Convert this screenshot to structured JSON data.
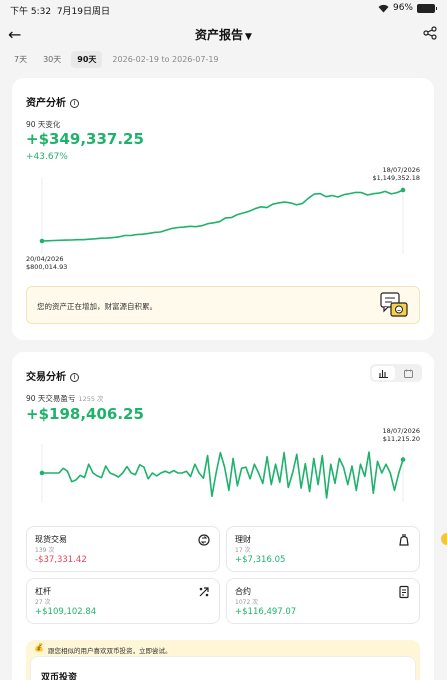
{
  "status_bar": {
    "time": "下午 5:32",
    "date": "7月19日周日",
    "battery": "96%"
  },
  "header": {
    "title": "资产报告",
    "caret": "▼"
  },
  "ranges": {
    "items": [
      "7天",
      "30天",
      "90天"
    ],
    "active": "90天",
    "date_range": "2026-02-19 to 2026-07-19"
  },
  "asset_analysis": {
    "title": "资产分析",
    "period_label": "90 天变化",
    "change_value": "+$349,337.25",
    "change_pct": "+43.67%",
    "start_label": {
      "date": "20/04/2026",
      "value": "$800,014.93"
    },
    "end_label": {
      "date": "18/07/2026",
      "value": "$1,149,352.18"
    },
    "notice": "您的资产正在增加，财富源自积累。",
    "chart_data": {
      "type": "line",
      "x_start": "20/04/2026",
      "x_end": "18/07/2026",
      "values": [
        800014.93,
        801200,
        803100,
        804800,
        806200,
        807000,
        808900,
        809100,
        812500,
        815000,
        819500,
        820100,
        823400,
        828000,
        838000,
        837500,
        844000,
        846500,
        852000,
        858900,
        862000,
        874800,
        886000,
        892500,
        895000,
        901000,
        898300,
        905000,
        918700,
        925000,
        932000,
        958300,
        960400,
        981000,
        992000,
        1003400,
        1021000,
        1034400,
        1028500,
        1052100,
        1061300,
        1066400,
        1061100,
        1048300,
        1056800,
        1092700,
        1121200,
        1125000,
        1103700,
        1111500,
        1101200,
        1117000,
        1124600,
        1132700,
        1131400,
        1115200,
        1124300,
        1127900,
        1139600,
        1122600,
        1131800,
        1149352.18
      ],
      "color": "#20b26c"
    }
  },
  "trade_analysis": {
    "title": "交易分析",
    "period_label": "90 天交易盈亏",
    "trade_count": "1255 次",
    "pnl_value": "+$198,406.25",
    "end_label": {
      "date": "18/07/2026",
      "value": "$11,215.20"
    },
    "chart_data": {
      "type": "line",
      "values": [
        0,
        0,
        0,
        0,
        0,
        800,
        300,
        -1500,
        -1200,
        -400,
        -800,
        1500,
        0,
        -500,
        -800,
        1200,
        0,
        -300,
        -700,
        0,
        1100,
        0,
        -300,
        1400,
        1000,
        -1000,
        0,
        -500,
        0,
        300,
        0,
        400,
        0,
        0,
        300,
        -600,
        1500,
        0,
        -900,
        3000,
        -4000,
        0,
        3500,
        1000,
        -3000,
        2500,
        -2200,
        800,
        1000,
        -1000,
        1500,
        0,
        -1800,
        2800,
        -2000,
        1500,
        -1600,
        3500,
        -2500,
        0,
        3200,
        -2600,
        1600,
        -3200,
        2500,
        -2000,
        3000,
        -4300,
        1500,
        -1800,
        2500,
        1000,
        -2000,
        1200,
        -3000,
        1500,
        -600,
        3600,
        -3500,
        2000,
        0,
        1500,
        0,
        -3000,
        0,
        2300
      ],
      "color": "#20b26c"
    },
    "tiles": [
      {
        "label": "现货交易",
        "count": "139 次",
        "value": "-$37,331.42",
        "sign": "neg",
        "icon": "spot-trade-icon"
      },
      {
        "label": "理财",
        "count": "17 次",
        "value": "+$7,316.05",
        "sign": "pos",
        "icon": "earn-icon"
      },
      {
        "label": "杠杆",
        "count": "27 次",
        "value": "+$109,102.84",
        "sign": "pos",
        "icon": "margin-icon"
      },
      {
        "label": "合约",
        "count": "1072 次",
        "value": "+$116,497.07",
        "sign": "pos",
        "icon": "contract-icon"
      }
    ],
    "promo": "跟您相似的用户喜欢双币投资，立即尝试。",
    "promo_title": "双币投资"
  }
}
